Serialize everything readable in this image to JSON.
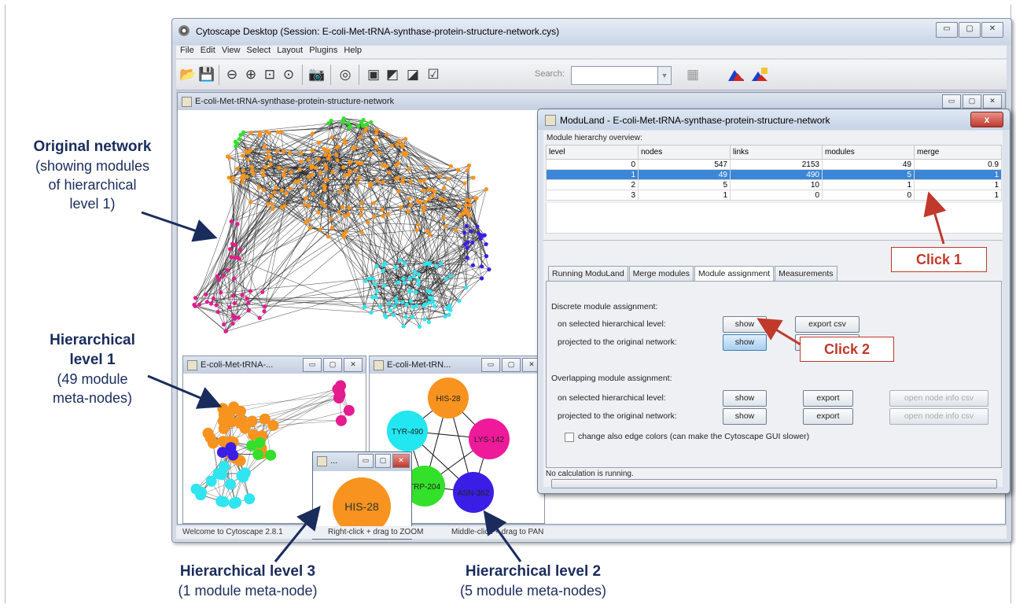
{
  "window": {
    "title": "Cytoscape Desktop (Session: E-coli-Met-tRNA-synthase-protein-structure-network.cys)",
    "controls": [
      "▭",
      "▢",
      "✕"
    ]
  },
  "menu": [
    "File",
    "Edit",
    "View",
    "Select",
    "Layout",
    "Plugins",
    "Help"
  ],
  "toolbar": {
    "search_label": "Search:",
    "search_value": ""
  },
  "status_bar": {
    "left": "Welcome to Cytoscape 2.8.1",
    "middle": "Right-click + drag to ZOOM",
    "right": "Middle-click + drag to PAN"
  },
  "network_views": {
    "main_title": "E-coli-Met-tRNA-synthase-protein-structure-network",
    "level1_title": "E-coli-Met-tRNA-...",
    "level2_title": "E-coli-Met-tRN...",
    "level3_title": "...",
    "level3_node": "HIS-28",
    "level2_nodes": [
      {
        "label": "HIS-28",
        "color": "#f7931e"
      },
      {
        "label": "LYS-142",
        "color": "#ee1a9a"
      },
      {
        "label": "ASN-362",
        "color": "#3a1ee6"
      },
      {
        "label": "TRP-204",
        "color": "#33e02a"
      },
      {
        "label": "TYR-490",
        "color": "#22e6f0"
      }
    ],
    "module_colors": {
      "orange": "#f7931e",
      "magenta": "#e41c8e",
      "cyan": "#2fe5f0",
      "blue": "#3a1ee6",
      "green": "#33e02a"
    }
  },
  "dialog": {
    "title": "ModuLand - E-coli-Met-tRNA-synthase-protein-structure-network",
    "close": "x",
    "hierarchy_title": "Module hierarchy overview:",
    "columns": [
      "level",
      "nodes",
      "links",
      "modules",
      "merge"
    ],
    "rows": [
      [
        "0",
        "547",
        "2153",
        "49",
        "0.9"
      ],
      [
        "1",
        "49",
        "490",
        "5",
        "1"
      ],
      [
        "2",
        "5",
        "10",
        "1",
        "1"
      ],
      [
        "3",
        "1",
        "0",
        "0",
        "1"
      ]
    ],
    "selected_row": 1,
    "tabs": [
      "Running ModuLand",
      "Merge modules",
      "Module assignment",
      "Measurements"
    ],
    "active_tab": 2,
    "discrete_title": "Discrete module assignment:",
    "on_selected": "on selected hierarchical level:",
    "projected": "projected to the original network:",
    "show": "show",
    "export_csv": "export csv",
    "overlapping_title": "Overlapping module assignment:",
    "export": "export",
    "open_node_info": "open node info csv",
    "checkbox_label": "change also edge colors (can make the Cytoscape GUI slower)",
    "status": "No calculation is running."
  },
  "callouts": {
    "click1": "Click 1",
    "click2": "Click 2",
    "arrow_color": "#c0392b",
    "navy": "#1a2c5c"
  },
  "annotations": {
    "original_title": "Original network",
    "original_sub": [
      "(showing modules",
      "of hierarchical",
      "level 1)"
    ],
    "level1_title": [
      "Hierarchical",
      "level 1"
    ],
    "level1_sub": [
      "(49 module",
      "meta-nodes)"
    ],
    "level3_title": "Hierarchical level 3",
    "level3_sub": "(1 module meta-node)",
    "level2_title": "Hierarchical level 2",
    "level2_sub": "(5 module meta-nodes)"
  }
}
